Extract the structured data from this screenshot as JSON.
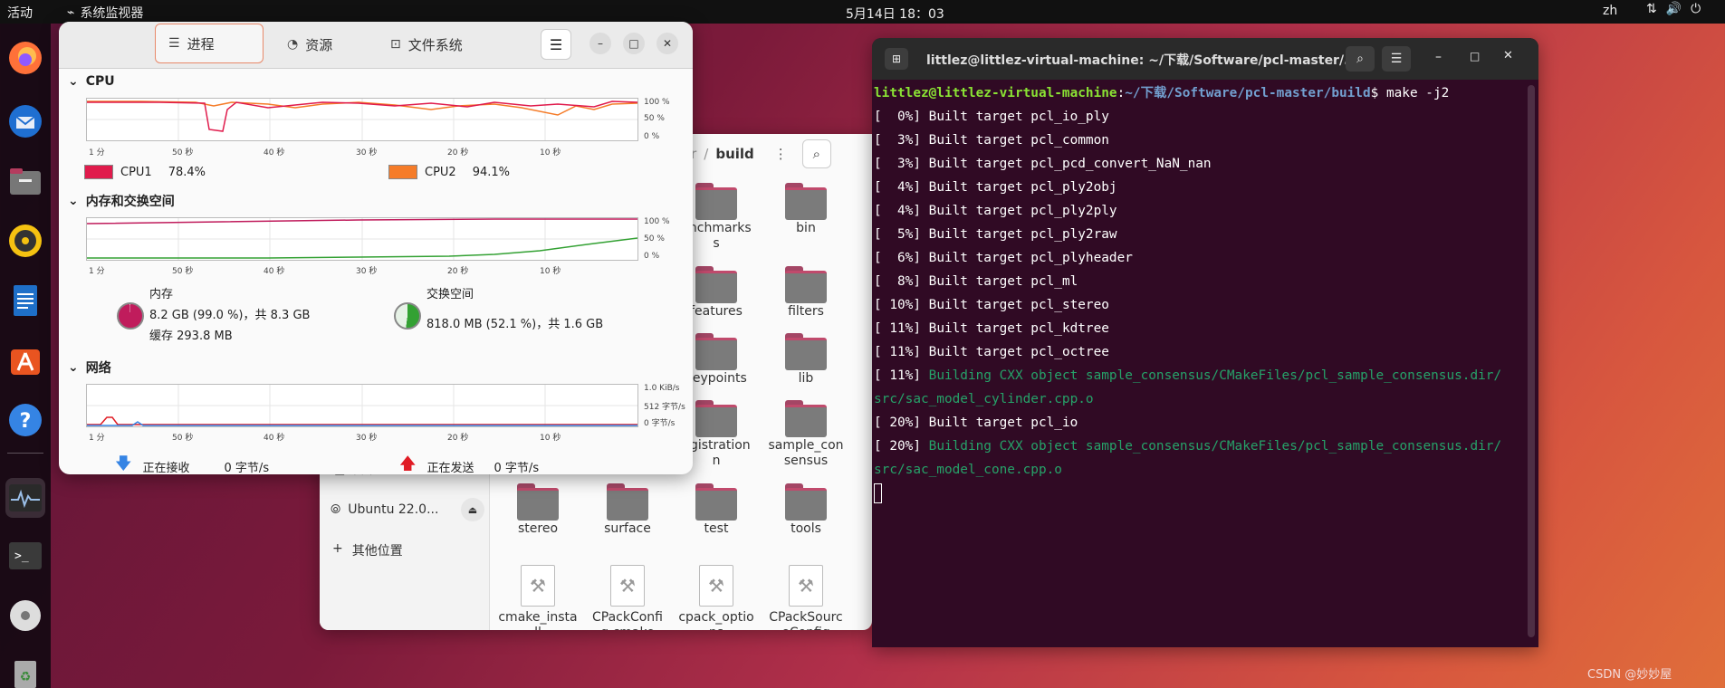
{
  "topbar": {
    "activities": "活动",
    "app_name": "系统监视器",
    "clock": "5月14日 18：03",
    "lang": "zh"
  },
  "sysmon": {
    "tabs": [
      {
        "label": "进程",
        "icon": "list-icon"
      },
      {
        "label": "资源",
        "icon": "gauge-icon"
      },
      {
        "label": "文件系统",
        "icon": "disk-icon"
      }
    ],
    "cpu_title": "CPU",
    "mem_title": "内存和交换空间",
    "net_title": "网络",
    "cpu_axis_x": [
      "1 分",
      "50 秒",
      "40 秒",
      "30 秒",
      "20 秒",
      "10 秒"
    ],
    "pct_axis_y": [
      "100 %",
      "50 %",
      "0 %"
    ],
    "net_axis_y": [
      "1.0 KiB/s",
      "512 字节/s",
      "0 字节/s"
    ],
    "cpu1_label": "CPU1",
    "cpu1_value": "78.4%",
    "cpu2_label": "CPU2",
    "cpu2_value": "94.1%",
    "mem_label": "内存",
    "mem_line1": "8.2 GB (99.0 %)，共 8.3 GB",
    "mem_line2": "缓存 293.8 MB",
    "swap_label": "交换空间",
    "swap_line1": "818.0 MB (52.1 %)，共 1.6 GB",
    "recv_label": "正在接收",
    "recv_value": "0 字节/s",
    "send_label": "正在发送",
    "send_value": "0 字节/s",
    "colors": {
      "cpu1": "#e01b4c",
      "cpu2": "#f57c29",
      "mem": "#c01c5c",
      "swap": "#33a133"
    }
  },
  "files": {
    "path_parent": "ter",
    "path_current": "build",
    "sidebar": {
      "volume": "Ubuntu 22.0...",
      "other": "其他位置",
      "partial": "□ 桌面"
    },
    "folders_row1": [
      "enchmarks",
      "bin"
    ],
    "folders_row2": [
      "features",
      "filters"
    ],
    "folders_row3": [
      "keypoints",
      "lib"
    ],
    "folders_row4": [
      "egistration",
      "sample_consensus"
    ],
    "folders_row5": [
      "stereo",
      "surface",
      "test",
      "tools"
    ],
    "files_row6": [
      "cmake_install",
      "CPackConfig.cmake",
      "cpack_options",
      "CPackSourceConfig"
    ]
  },
  "terminal": {
    "title": "littlez@littlez-virtual-machine: ~/下载/Software/pcl-master/...",
    "prompt_user": "littlez@littlez-virtual-machine",
    "prompt_path": "~/下载/Software/pcl-master/build",
    "command": "$ make -j2",
    "lines": [
      {
        "pct": "[  0%]",
        "text": "Built target pcl_io_ply",
        "kind": "target"
      },
      {
        "pct": "[  3%]",
        "text": "Built target pcl_common",
        "kind": "target"
      },
      {
        "pct": "[  3%]",
        "text": "Built target pcl_pcd_convert_NaN_nan",
        "kind": "target"
      },
      {
        "pct": "[  4%]",
        "text": "Built target pcl_ply2obj",
        "kind": "target"
      },
      {
        "pct": "[  4%]",
        "text": "Built target pcl_ply2ply",
        "kind": "target"
      },
      {
        "pct": "[  5%]",
        "text": "Built target pcl_ply2raw",
        "kind": "target"
      },
      {
        "pct": "[  6%]",
        "text": "Built target pcl_plyheader",
        "kind": "target"
      },
      {
        "pct": "[  8%]",
        "text": "Built target pcl_ml",
        "kind": "target"
      },
      {
        "pct": "[ 10%]",
        "text": "Built target pcl_stereo",
        "kind": "target"
      },
      {
        "pct": "[ 11%]",
        "text": "Built target pcl_kdtree",
        "kind": "target"
      },
      {
        "pct": "[ 11%]",
        "text": "Built target pcl_octree",
        "kind": "target"
      },
      {
        "pct": "[ 11%]",
        "text": "Building CXX object sample_consensus/CMakeFiles/pcl_sample_consensus.dir/",
        "kind": "build"
      },
      {
        "pct": "",
        "text": "src/sac_model_cylinder.cpp.o",
        "kind": "build-cont"
      },
      {
        "pct": "[ 20%]",
        "text": "Built target pcl_io",
        "kind": "target"
      },
      {
        "pct": "[ 20%]",
        "text": "Building CXX object sample_consensus/CMakeFiles/pcl_sample_consensus.dir/",
        "kind": "build"
      },
      {
        "pct": "",
        "text": "src/sac_model_cone.cpp.o",
        "kind": "build-cont"
      }
    ]
  },
  "watermark": "CSDN @妙妙屋"
}
